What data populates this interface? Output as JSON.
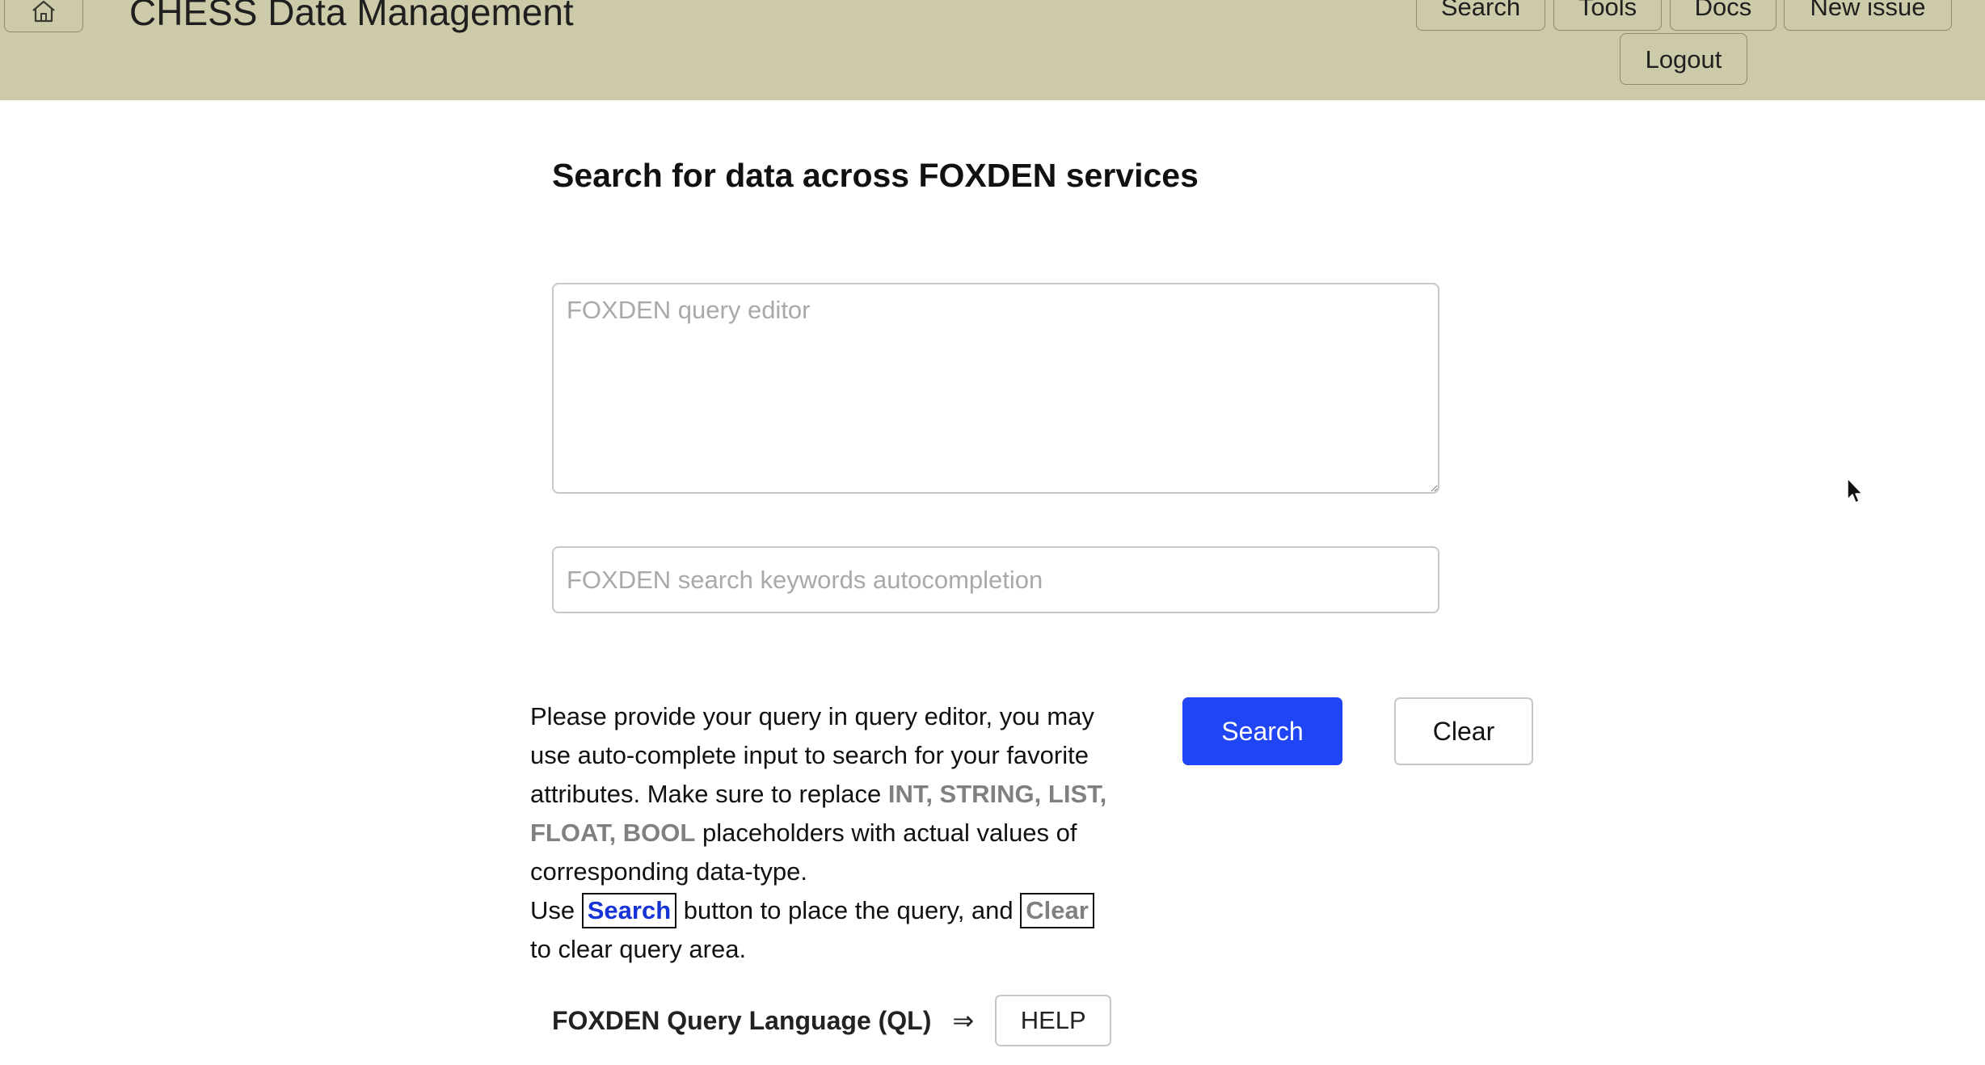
{
  "header": {
    "app_title": "CHESS Data Management",
    "home_icon": "home-icon",
    "nav": {
      "search": "Search",
      "tools": "Tools",
      "docs": "Docs",
      "new_issue": "New issue",
      "logout": "Logout"
    },
    "background_color": "#cccaa9"
  },
  "main": {
    "heading": "Search for data across FOXDEN services",
    "query_editor": {
      "placeholder": "FOXDEN query editor",
      "value": ""
    },
    "keywords_input": {
      "placeholder": "FOXDEN search keywords autocompletion",
      "value": ""
    },
    "instructions": {
      "part1": "Please provide your query in query editor, you may use auto-complete input to search for your favorite attributes. Make sure to replace ",
      "placeholders": "INT, STRING, LIST, FLOAT, BOOL",
      "part2": " placeholders with actual values of corresponding data-type.",
      "use": "Use ",
      "search_word": "Search",
      "middle": " button to place the query, and ",
      "clear_word": "Clear",
      "end": " to clear query area."
    },
    "buttons": {
      "search": "Search",
      "clear": "Clear",
      "search_color": "#1f45f5"
    },
    "ql": {
      "label": "FOXDEN Query Language (QL)",
      "arrow": "⇒",
      "help": "HELP"
    }
  }
}
